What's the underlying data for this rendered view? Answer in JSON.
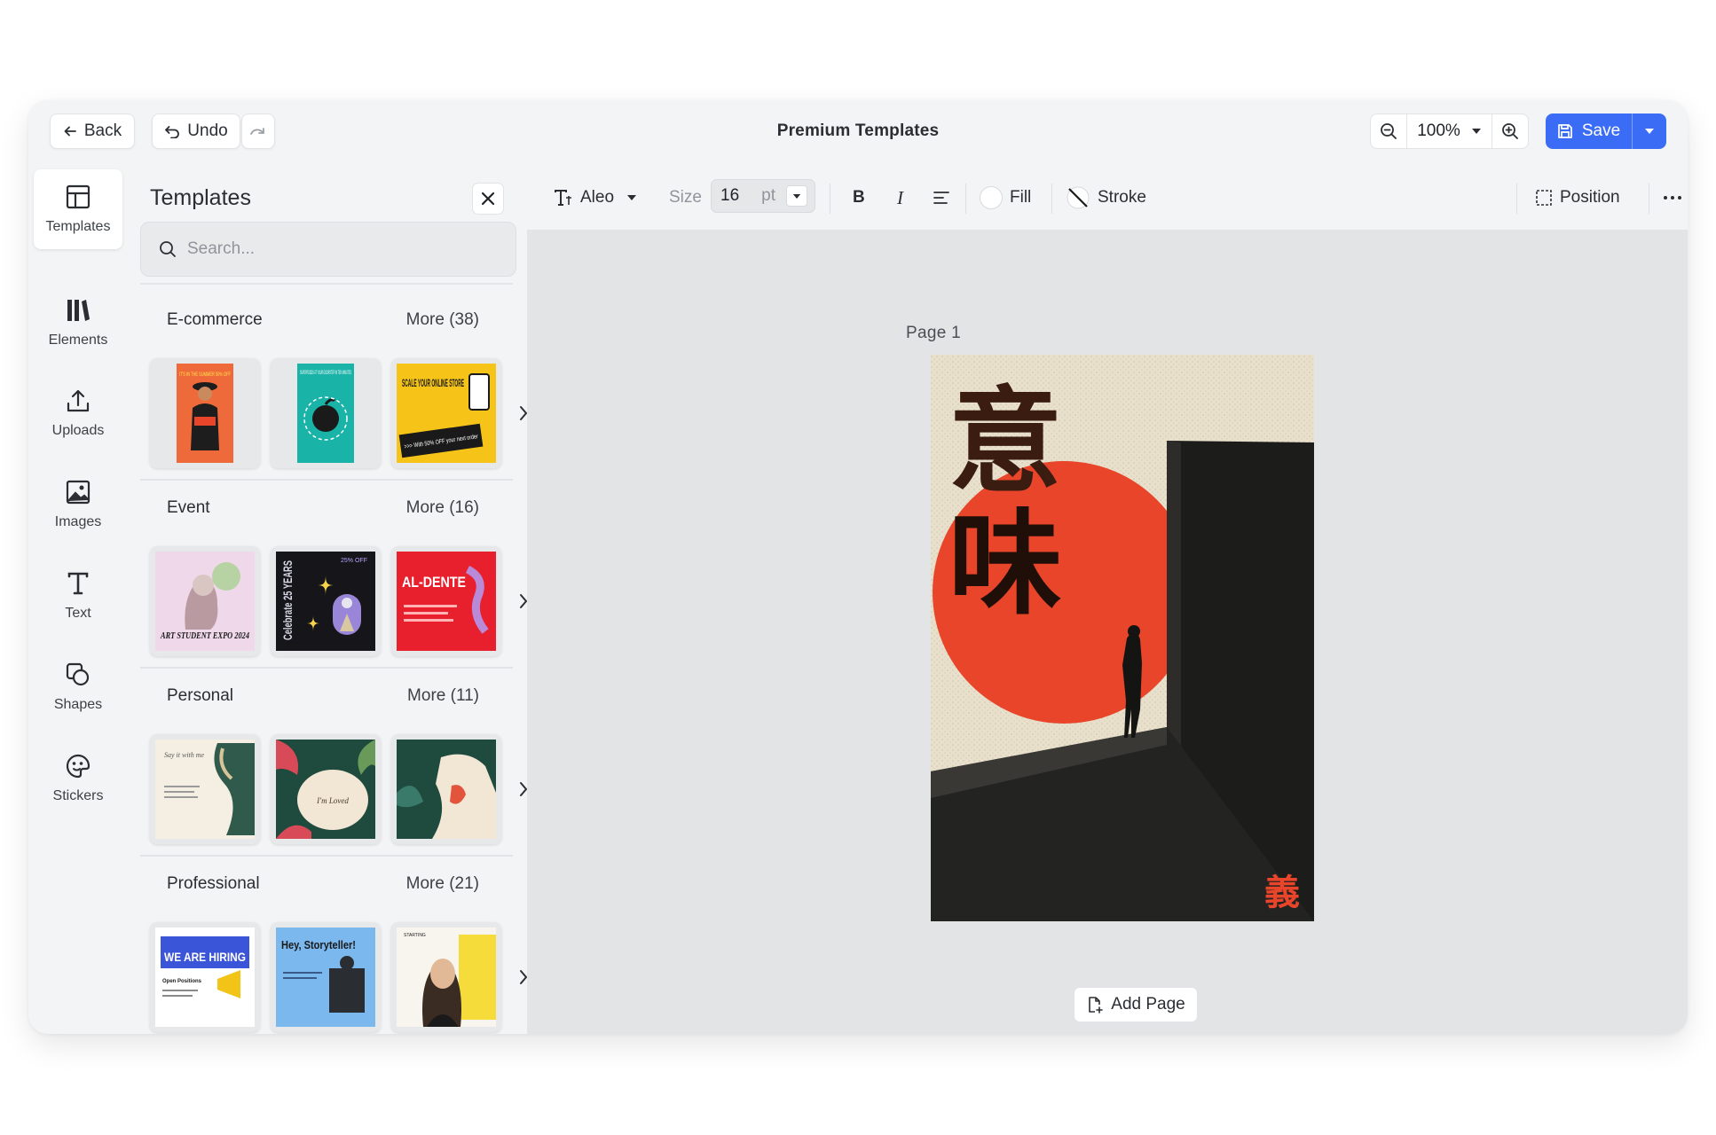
{
  "header": {
    "back_label": "Back",
    "undo_label": "Undo",
    "title": "Premium Templates",
    "zoom": "100%",
    "save_label": "Save"
  },
  "rail": {
    "items": [
      {
        "label": "Templates",
        "icon": "templates-icon"
      },
      {
        "label": "Elements",
        "icon": "elements-icon"
      },
      {
        "label": "Uploads",
        "icon": "upload-icon"
      },
      {
        "label": "Images",
        "icon": "image-icon"
      },
      {
        "label": "Text",
        "icon": "text-icon"
      },
      {
        "label": "Shapes",
        "icon": "shapes-icon"
      },
      {
        "label": "Stickers",
        "icon": "sticker-icon"
      }
    ]
  },
  "panel": {
    "title": "Templates",
    "search_placeholder": "Search...",
    "sections": [
      {
        "name": "E-commerce",
        "more": "More (38)",
        "thumbs": [
          {
            "text": "IT'S IN THE SUMMER  50% OFF"
          },
          {
            "text": "SUPERFOODS AT YOUR DOORSTEP IN TEN MINUTES"
          },
          {
            "text": "SCALE YOUR ONLINE STORE",
            "subtext": ">>> With 50% OFF your next order"
          }
        ]
      },
      {
        "name": "Event",
        "more": "More (16)",
        "thumbs": [
          {
            "text": "ART STUDENT EXPO 2024"
          },
          {
            "text": "Celebrate 25 YEARS",
            "subtext": "25% OFF"
          },
          {
            "text": "AL-DENTE"
          }
        ]
      },
      {
        "name": "Personal",
        "more": "More (11)",
        "thumbs": [
          {
            "text": "Say it with me"
          },
          {
            "text": "I'm Loved"
          },
          {
            "text": ""
          }
        ]
      },
      {
        "name": "Professional",
        "more": "More (21)",
        "thumbs": [
          {
            "text": "WE ARE HIRING",
            "subtext": "Open Positions"
          },
          {
            "text": "Hey, Storyteller!"
          },
          {
            "text": "STARTING"
          }
        ]
      }
    ]
  },
  "toolbar": {
    "font": "Aleo",
    "size_label": "Size",
    "size_value": "16",
    "size_unit": "pt",
    "bold": "B",
    "italic": "I",
    "fill_label": "Fill",
    "stroke_label": "Stroke",
    "position_label": "Position"
  },
  "canvas": {
    "page_label": "Page  1",
    "poster": {
      "kanji_1": "意",
      "kanji_2": "味",
      "kanji_corner": "義"
    },
    "add_page_label": "Add Page"
  },
  "colors": {
    "accent": "#3b6cf6",
    "poster_red": "#e8452a",
    "poster_paper": "#e8e0cb"
  }
}
